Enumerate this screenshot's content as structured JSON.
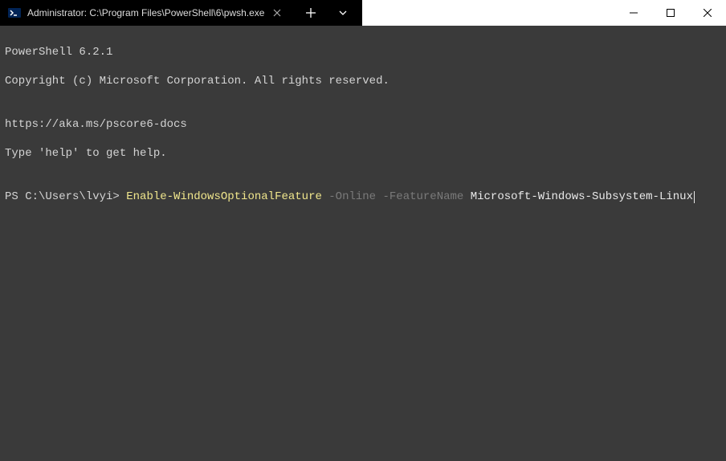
{
  "tab": {
    "title": "Administrator: C:\\Program Files\\PowerShell\\6\\pwsh.exe"
  },
  "terminal": {
    "line1": "PowerShell 6.2.1",
    "line2": "Copyright (c) Microsoft Corporation. All rights reserved.",
    "line3": "",
    "line4": "https://aka.ms/pscore6-docs",
    "line5": "Type 'help' to get help.",
    "line6": "",
    "prompt": "PS C:\\Users\\lvyi> ",
    "cmd_cmdlet": "Enable-WindowsOptionalFeature",
    "cmd_params": " -Online -FeatureName ",
    "cmd_arg": "Microsoft-Windows-Subsystem-Linux"
  }
}
